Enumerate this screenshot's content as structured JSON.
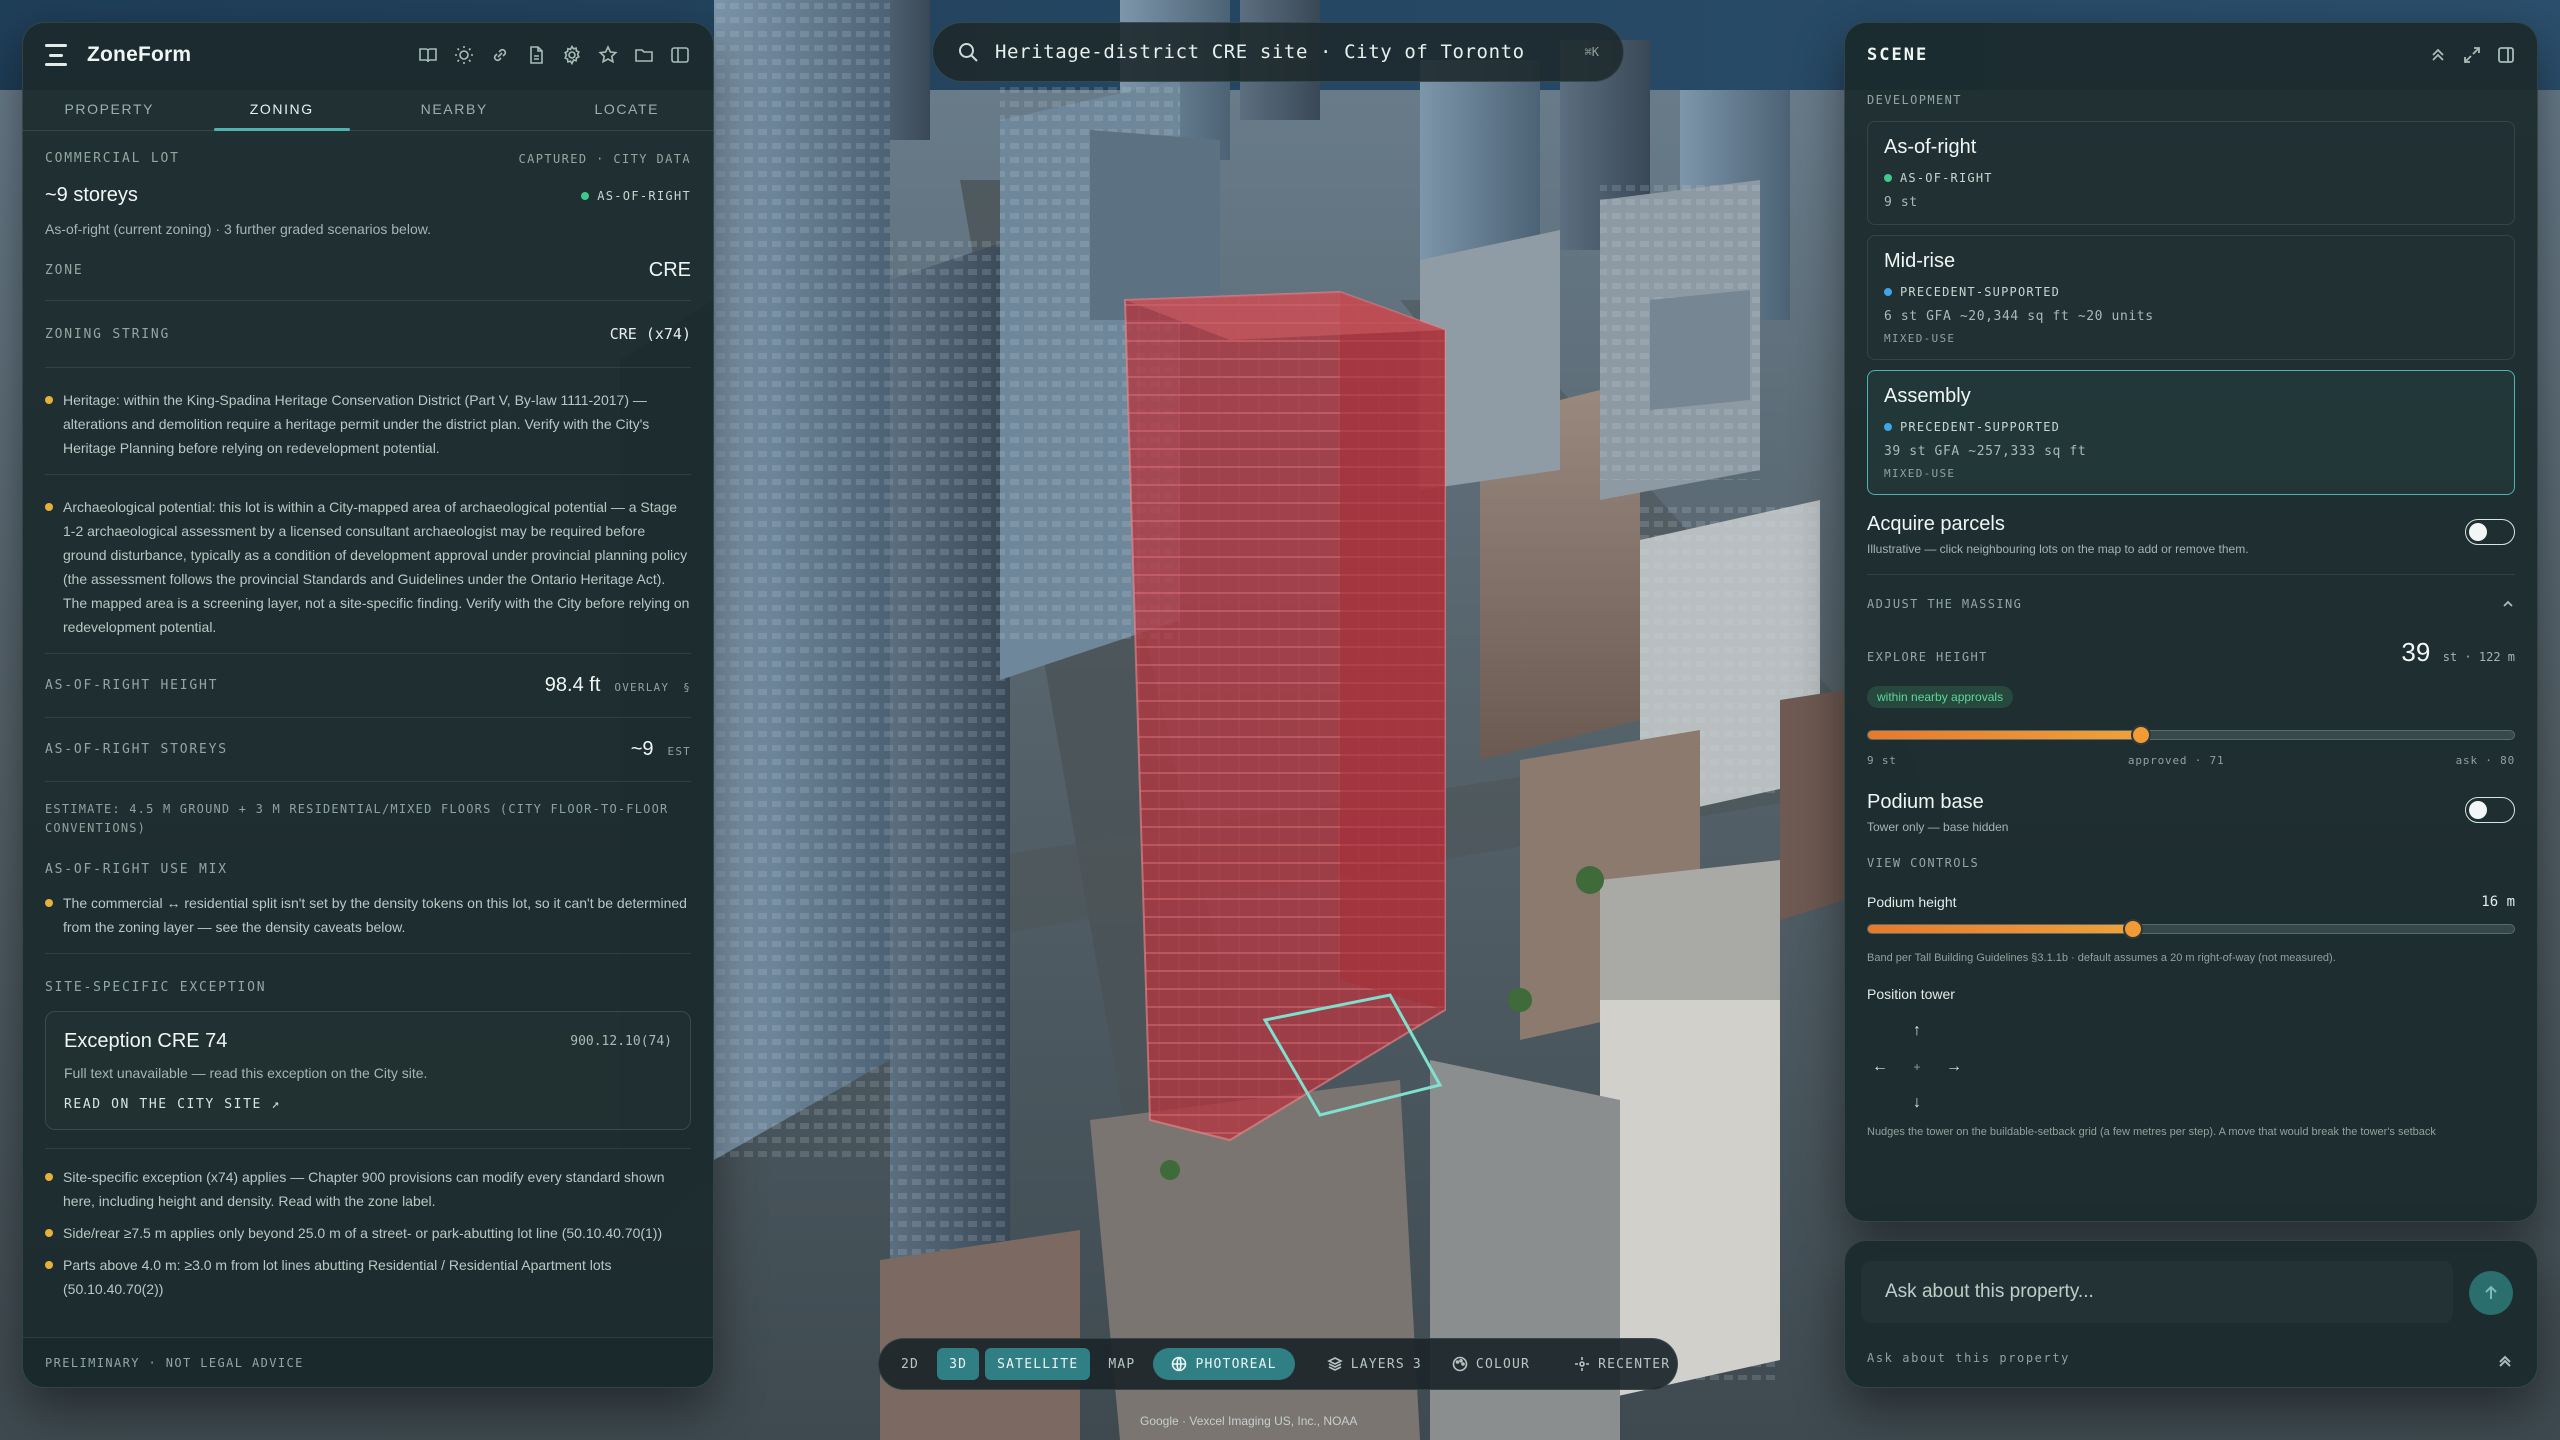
{
  "app": {
    "title": "ZoneForm"
  },
  "left_panel": {
    "tabs": [
      {
        "label": "PROPERTY",
        "active": false
      },
      {
        "label": "ZONING",
        "active": true
      },
      {
        "label": "NEARBY",
        "active": false
      },
      {
        "label": "LOCATE",
        "active": false
      }
    ],
    "lot_type": "COMMERCIAL LOT",
    "captured": "CAPTURED · CITY DATA",
    "storeys": "~9 storeys",
    "storeys_badge": "AS-OF-RIGHT",
    "subtext": "As-of-right (current zoning) · 3 further graded scenarios below.",
    "zone_label": "ZONE",
    "zone_value": "CRE",
    "zoning_string_label": "ZONING STRING",
    "zoning_string_value": "CRE (x74)",
    "caveats": [
      "Heritage: within the King-Spadina Heritage Conservation District (Part V, By-law 1111-2017) — alterations and demolition require a heritage permit under the district plan. Verify with the City's Heritage Planning before relying on redevelopment potential.",
      "Archaeological potential: this lot is within a City-mapped area of archaeological potential — a Stage 1-2 archaeological assessment by a licensed consultant archaeologist may be required before ground disturbance, typically as a condition of development approval under provincial planning policy (the assessment follows the provincial Standards and Guidelines under the Ontario Heritage Act). The mapped area is a screening layer, not a site-specific finding. Verify with the City before relying on redevelopment potential."
    ],
    "aor_height_label": "AS-OF-RIGHT HEIGHT",
    "aor_height_value": "98.4 ft",
    "aor_height_tag": "OVERLAY",
    "aor_height_ref": "§",
    "aor_storeys_label": "AS-OF-RIGHT STOREYS",
    "aor_storeys_value": "~9",
    "aor_storeys_tag": "EST",
    "estimate_note": "ESTIMATE: 4.5 M GROUND + 3 M RESIDENTIAL/MIXED FLOORS (CITY FLOOR-TO-FLOOR CONVENTIONS)",
    "use_mix_label": "AS-OF-RIGHT USE MIX",
    "use_mix_note": "The commercial ↔ residential split isn't set by the density tokens on this lot, so it can't be determined from the zoning layer — see the density caveats below.",
    "exception_section_label": "SITE-SPECIFIC EXCEPTION",
    "exception": {
      "title": "Exception CRE 74",
      "code": "900.12.10(74)",
      "body": "Full text unavailable — read this exception on the City site.",
      "link": "READ ON THE CITY SITE ↗"
    },
    "exception_notes": [
      "Site-specific exception (x74) applies — Chapter 900 provisions can modify every standard shown here, including height and density. Read with the zone label.",
      "Side/rear ≥7.5 m applies only beyond 25.0 m of a street- or park-abutting lot line (50.10.40.70(1))",
      "Parts above 4.0 m: ≥3.0 m from lot lines abutting Residential / Residential Apartment lots (50.10.40.70(2))"
    ],
    "footer": "PRELIMINARY · NOT LEGAL ADVICE"
  },
  "search": {
    "query": "Heritage-district CRE site · City of Toronto",
    "shortcut": "⌘K"
  },
  "toolbar": {
    "btn_2d": "2D",
    "btn_3d": "3D",
    "btn_satellite": "SATELLITE",
    "btn_map": "MAP",
    "btn_photoreal": "PHOTOREAL",
    "btn_layers": "LAYERS",
    "layers_count": "3",
    "btn_colour": "COLOUR",
    "btn_recenter": "RECENTER"
  },
  "attribution": "Google · Vexcel Imaging US, Inc., NOAA",
  "right_panel": {
    "title": "SCENE",
    "development_label": "DEVELOPMENT",
    "scenarios": [
      {
        "title": "As-of-right",
        "badge": "AS-OF-RIGHT",
        "badge_color": "#3fc98a",
        "line": "9 st",
        "sub": "",
        "active": false
      },
      {
        "title": "Mid-rise",
        "badge": "PRECEDENT-SUPPORTED",
        "badge_color": "#3ea6e6",
        "line": "6 st  GFA ~20,344 sq ft  ~20 units",
        "sub": "MIXED-USE",
        "active": false
      },
      {
        "title": "Assembly",
        "badge": "PRECEDENT-SUPPORTED",
        "badge_color": "#3ea6e6",
        "line": "39 st  GFA ~257,333 sq ft",
        "sub": "MIXED-USE",
        "active": true
      }
    ],
    "acquire": {
      "title": "Acquire parcels",
      "sub": "Illustrative — click neighbouring lots on the map to add or remove them.",
      "on": false
    },
    "massing_label": "ADJUST THE MASSING",
    "explore_height_label": "EXPLORE HEIGHT",
    "explore_height_value": "39",
    "explore_height_unit": "st · 122 m",
    "approval_chip": "within nearby approvals",
    "height_slider": {
      "min": 9,
      "max": 80,
      "value": 39
    },
    "scale_min": "9 st",
    "scale_mid": "approved · 71",
    "scale_max": "ask · 80",
    "podium": {
      "title": "Podium base",
      "sub": "Tower only — base hidden",
      "on": false
    },
    "view_controls_label": "VIEW CONTROLS",
    "podium_height_label": "Podium height",
    "podium_height_value": "16 m",
    "podium_slider": {
      "fraction": 0.41
    },
    "podium_note": "Band per Tall Building Guidelines §3.1.1b · default assumes a 20 m right-of-way (not measured).",
    "position_label": "Position tower",
    "dpad": {
      "up": "↑",
      "down": "↓",
      "left": "←",
      "right": "→",
      "center": "+"
    },
    "nudge_note": "Nudges the tower on the buildable-setback grid (a few metres per step). A move that would break the tower's setback"
  },
  "chat": {
    "placeholder": "Ask about this property...",
    "hint": "Ask about this property"
  },
  "colors": {
    "accent": "#4fb3b0",
    "tower": "#c23a44",
    "slider": "#f29a36",
    "ok": "#3fc98a",
    "precedent": "#3ea6e6",
    "warn": "#e6b13b"
  }
}
